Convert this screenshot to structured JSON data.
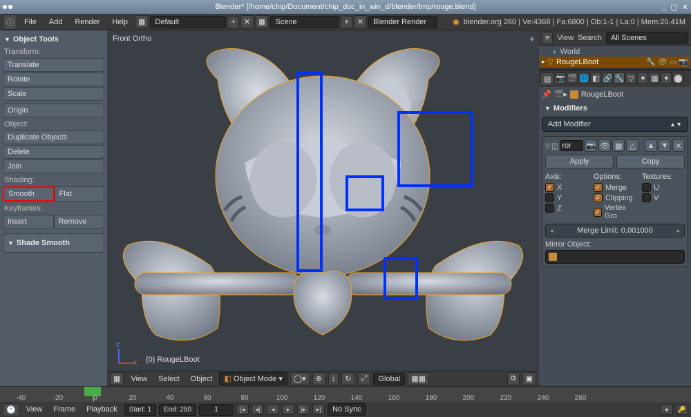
{
  "window": {
    "title": "Blender* [/home/chip/Document/chip_doc_in_win_d/blender/tmp/rouge.blend]"
  },
  "topbar": {
    "menu": [
      "File",
      "Add",
      "Render",
      "Help"
    ],
    "layout": "Default",
    "scene": "Scene",
    "engine": "Blender Render",
    "info": "blender.org 260 | Ve:4368 | Fa:6800 | Ob:1-1 | La:0 | Mem:20.41M"
  },
  "left_panel": {
    "title": "Object Tools",
    "sections": {
      "transform": {
        "label": "Transform:",
        "buttons": [
          "Translate",
          "Rotate",
          "Scale"
        ]
      },
      "origin": "Origin",
      "object": {
        "label": "Object:",
        "buttons": [
          "Duplicate Objects",
          "Delete",
          "Join"
        ]
      },
      "shading": {
        "label": "Shading:",
        "smooth": "Smooth",
        "flat": "Flat"
      },
      "keyframes": {
        "label": "Keyframes:",
        "insert": "Insert",
        "remove": "Remove"
      }
    },
    "last_op": "Shade Smooth"
  },
  "viewport": {
    "label": "Front Ortho",
    "object_name": "(0) RougeLBoot",
    "header": {
      "menus": [
        "View",
        "Select",
        "Object"
      ],
      "mode": "Object Mode",
      "orientation": "Global"
    }
  },
  "right_panel": {
    "outliner_header": {
      "menus": [
        "View",
        "Search"
      ],
      "filter": "All Scenes"
    },
    "outliner": {
      "world": "World",
      "selected": "RougeLBoot"
    },
    "breadcrumb": "RougeLBoot",
    "modifiers_title": "Modifiers",
    "add_modifier": "Add Modifier",
    "modifier": {
      "name": "ror",
      "apply": "Apply",
      "copy": "Copy",
      "axis_label": "Axis:",
      "options_label": "Options:",
      "textures_label": "Textures:",
      "axis": {
        "X": true,
        "Y": false,
        "Z": false
      },
      "options": {
        "Merge": true,
        "Clipping": true,
        "Vertex Gro": true
      },
      "textures": {
        "U": false,
        "V": false
      },
      "merge_limit_label": "Merge Limit: 0.001000",
      "mirror_object_label": "Mirror Object:"
    }
  },
  "timeline": {
    "ticks": [
      "-40",
      "-20",
      "0",
      "20",
      "40",
      "60",
      "80",
      "100",
      "120",
      "140",
      "160",
      "180",
      "200",
      "220",
      "240",
      "260"
    ],
    "menus": [
      "View",
      "Frame",
      "Playback"
    ],
    "start": "Start: 1",
    "end": "End: 250",
    "current": "1",
    "sync": "No Sync"
  }
}
